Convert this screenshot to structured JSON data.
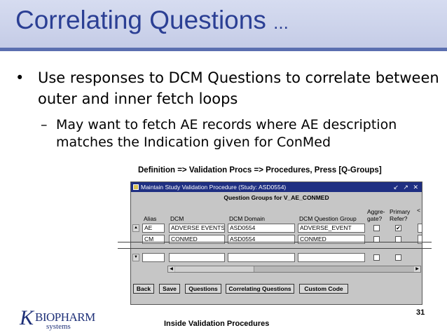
{
  "slide": {
    "title": "Correlating Questions",
    "title_suffix": "...",
    "bullet1": "Use responses to DCM Questions to correlate between outer and inner fetch loops",
    "bullet2": "May want to fetch AE records where AE description matches the Indication given for ConMed",
    "nav_caption": "Definition => Validation Procs => Procedures, Press [Q-Groups]",
    "page_number": "31",
    "footer": "Inside Validation Procedures",
    "logo_text": "BIOPHARM",
    "logo_sub": "systems"
  },
  "window": {
    "title": "Maintain Study Validation Procedure (Study: ASD0554)",
    "controls": "↙ ↗ ✕",
    "group_title": "Question Groups for V_AE_CONMED",
    "columns": {
      "alias": "Alias",
      "dcm": "DCM",
      "dcm_domain": "DCM Domain",
      "dcm_question_group": "DCM Question Group",
      "aggregate": "Aggre- gate?",
      "primary_refer": "Primary Refer?"
    },
    "rows": [
      {
        "alias": "AE",
        "dcm": "ADVERSE EVENTS",
        "domain": "ASD0554",
        "group": "ADVERSE_EVENT",
        "aggregate": "",
        "primary": "✔"
      },
      {
        "alias": "CM",
        "dcm": "CONMED",
        "domain": "ASD0554",
        "group": "CONMED",
        "aggregate": "",
        "primary": ""
      }
    ],
    "buttons": {
      "back": "Back",
      "save": "Save",
      "questions": "Questions",
      "correlating": "Correlating Questions",
      "custom_code": "Custom Code"
    },
    "colors": {
      "titlebar": "#1f2f82",
      "body": "#c6c6c6"
    }
  }
}
